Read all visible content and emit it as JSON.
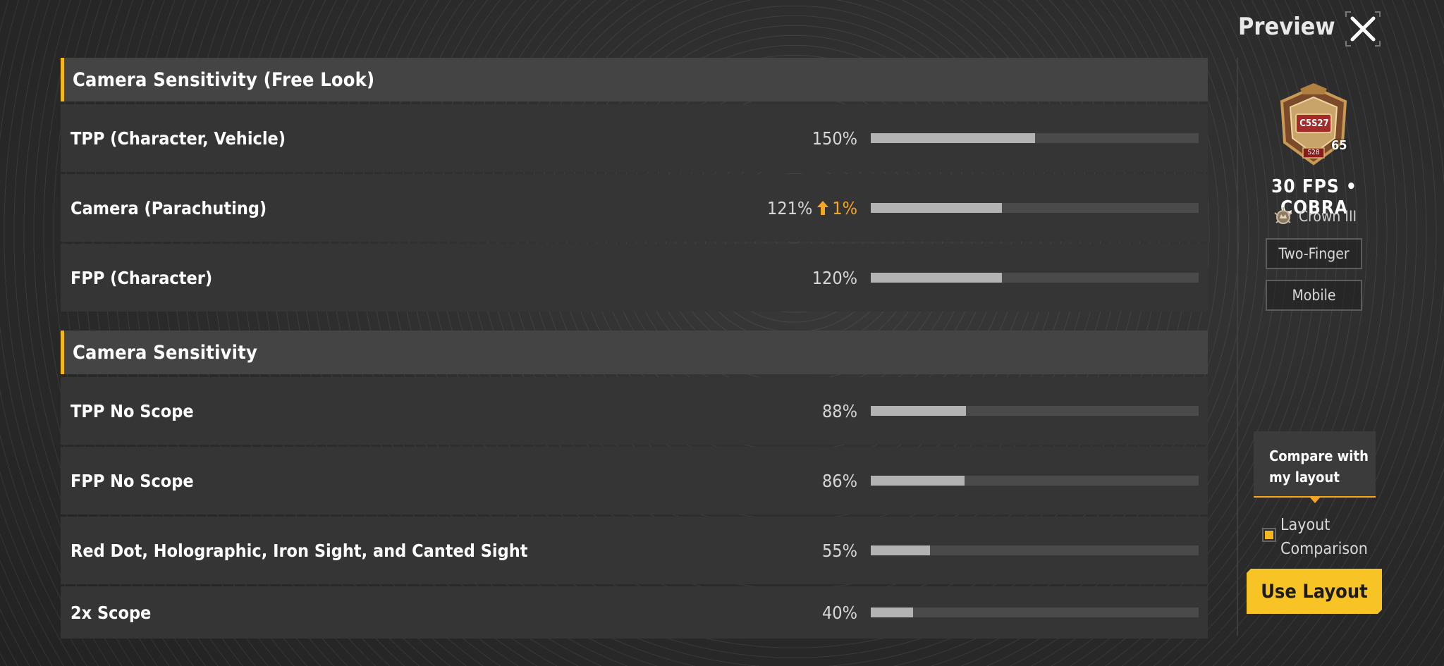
{
  "header": {
    "title": "Preview"
  },
  "sections": [
    {
      "title": "Camera Sensitivity (Free Look)",
      "rows": [
        {
          "label": "TPP (Character, Vehicle)",
          "value": "150%",
          "fill": 0.5
        },
        {
          "label": "Camera (Parachuting)",
          "value": "121%",
          "delta": "1%",
          "fill": 0.4
        },
        {
          "label": "FPP (Character)",
          "value": "120%",
          "fill": 0.4
        }
      ]
    },
    {
      "title": "Camera Sensitivity",
      "rows": [
        {
          "label": "TPP No Scope",
          "value": "88%",
          "fill": 0.29
        },
        {
          "label": "FPP No Scope",
          "value": "86%",
          "fill": 0.285
        },
        {
          "label": "Red Dot, Holographic, Iron Sight, and Canted Sight",
          "value": "55%",
          "fill": 0.18
        },
        {
          "label": "2x Scope",
          "value": "40%",
          "fill": 0.13
        }
      ]
    }
  ],
  "profile": {
    "badge_text": "C5S27",
    "badge_level": "65",
    "badge_season": "S28",
    "name": "30 FPS • COBRA",
    "rank": "Crown III",
    "tags": [
      "Two-Finger",
      "Mobile"
    ]
  },
  "compare": {
    "tooltip": "Compare with my layout",
    "checkbox_label": "Layout Comparison",
    "checked": true
  },
  "use_button": "Use Layout",
  "colors": {
    "accent": "#f5b81c",
    "delta": "#f5a623",
    "button": "#f7c325"
  }
}
